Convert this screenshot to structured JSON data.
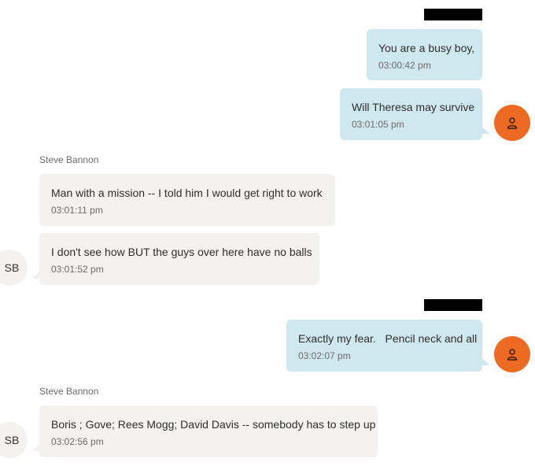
{
  "colors": {
    "outgoing_bubble": "#cfe8f0",
    "incoming_bubble": "#f3f2ef",
    "my_avatar": "#ed6a22",
    "redaction": "#000000"
  },
  "icons": {
    "my_avatar": "person-icon"
  },
  "messages": [
    {
      "direction": "outgoing",
      "text": "You are a busy boy,",
      "time": "03:00:42 pm"
    },
    {
      "direction": "outgoing",
      "text": "Will Theresa may survive",
      "time": "03:01:05 pm"
    },
    {
      "direction": "incoming",
      "sender": "Steve Bannon",
      "text": "Man with a mission -- I told him I would get right to work",
      "time": "03:01:11 pm"
    },
    {
      "direction": "incoming",
      "text": "I don't see how BUT the guys over here have no balls",
      "time": "03:01:52 pm",
      "avatar_initials": "SB"
    },
    {
      "direction": "outgoing",
      "text": "Exactly my fear.   Pencil neck and all",
      "time": "03:02:07 pm"
    },
    {
      "direction": "incoming",
      "sender": "Steve Bannon",
      "text": "Boris ; Gove; Rees Mogg; David Davis -- somebody has to step up",
      "time": "03:02:56 pm",
      "avatar_initials": "SB"
    }
  ]
}
